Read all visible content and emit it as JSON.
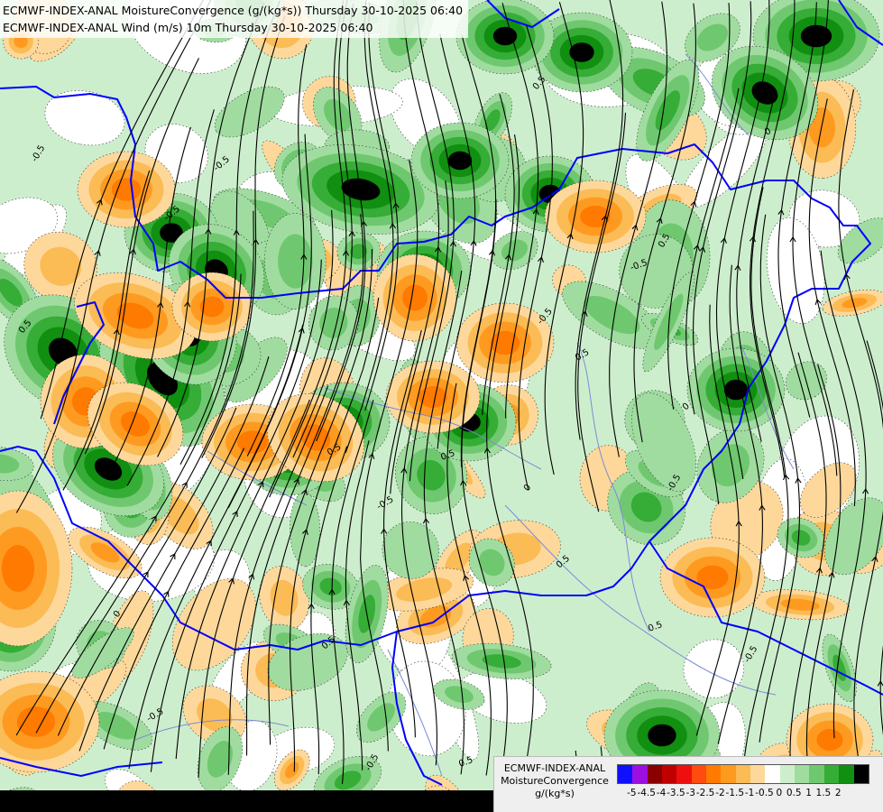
{
  "header": {
    "line1": "ECMWF-INDEX-ANAL MoistureConvergence (g/(kg*s)) Thursday 30-10-2025 06:40",
    "line2": "ECMWF-INDEX-ANAL Wind (m/s) 10m Thursday 30-10-2025 06:40"
  },
  "legend": {
    "title_line1": "ECMWF-INDEX-ANAL",
    "title_line2": "MoistureConvergence",
    "unit": "g/(kg*s)",
    "colors": [
      "#1010ff",
      "#9b10e0",
      "#8a0000",
      "#c00000",
      "#ee1010",
      "#ff4a10",
      "#ff7a00",
      "#ff9a20",
      "#fbbb55",
      "#fdd89a",
      "#ffffff",
      "#cdeecd",
      "#a0dca0",
      "#6fc86f",
      "#36ad36",
      "#108f10",
      "#000000"
    ],
    "ticks": [
      "-5",
      "-4.5",
      "-4",
      "-3.5",
      "-3",
      "-2.5",
      "-2",
      "-1.5",
      "-1",
      "-0.5",
      "0",
      "0.5",
      "1",
      "1.5",
      "2"
    ]
  },
  "map": {
    "contour_labels": [
      "-0.5",
      "0.5",
      "-0.5",
      "0",
      "-0.5",
      "0.5",
      "-0.5",
      "0",
      "0.5",
      "0.5",
      "-0.5",
      "0",
      "0.5",
      "-0.5",
      "0.5",
      "-0.5",
      "0",
      "0.5",
      "-0.5",
      "0.5",
      "-0.5",
      "0.5",
      "-0.5",
      "0.5"
    ],
    "colors": {
      "border": "#0000ff",
      "river": "#7a8cd6",
      "streamline": "#000000"
    }
  }
}
